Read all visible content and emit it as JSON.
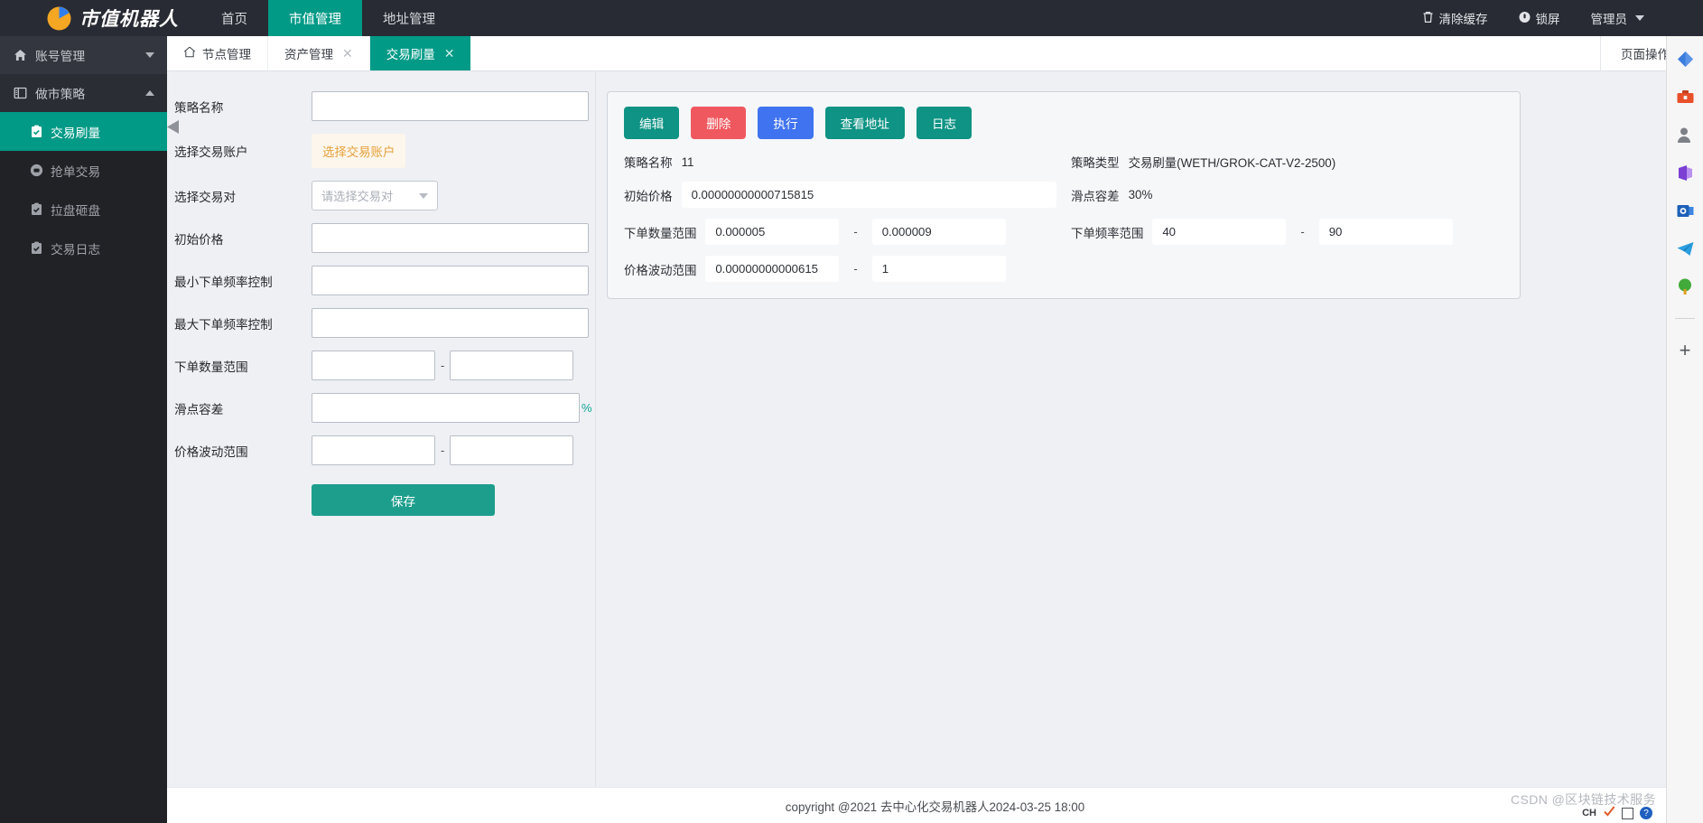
{
  "header": {
    "brand": "市值机器人",
    "nav": [
      {
        "label": "首页",
        "active": false
      },
      {
        "label": "市值管理",
        "active": true
      },
      {
        "label": "地址管理",
        "active": false
      }
    ],
    "right": [
      {
        "label": "清除缓存",
        "icon": "trash-icon"
      },
      {
        "label": "锁屏",
        "icon": "lock-icon"
      },
      {
        "label": "管理员",
        "icon": "caret-down-icon"
      }
    ]
  },
  "sidebar": {
    "groups": [
      {
        "label": "账号管理",
        "icon": "home-icon",
        "expanded": false,
        "items": []
      },
      {
        "label": "做市策略",
        "icon": "book-icon",
        "expanded": true,
        "items": [
          {
            "label": "交易刷量",
            "icon": "clipboard-check-icon",
            "active": true
          },
          {
            "label": "抢单交易",
            "icon": "circle-dot-icon",
            "active": false
          },
          {
            "label": "拉盘砸盘",
            "icon": "clipboard-check-icon",
            "active": false
          },
          {
            "label": "交易日志",
            "icon": "clipboard-check-icon",
            "active": false
          }
        ]
      }
    ]
  },
  "tabs": {
    "items": [
      {
        "label": "节点管理",
        "icon": "home-icon",
        "closable": false,
        "active": false
      },
      {
        "label": "资产管理",
        "icon": "",
        "closable": true,
        "active": false
      },
      {
        "label": "交易刷量",
        "icon": "",
        "closable": true,
        "active": true
      }
    ],
    "close_glyph": "✕",
    "page_ops": "页面操作"
  },
  "form": {
    "strategy_name": {
      "label": "策略名称",
      "value": "",
      "placeholder": ""
    },
    "select_account": {
      "label": "选择交易账户",
      "button_label": "选择交易账户"
    },
    "select_pair": {
      "label": "选择交易对",
      "placeholder": "请选择交易对",
      "value": ""
    },
    "initial_price": {
      "label": "初始价格",
      "value": "",
      "placeholder": ""
    },
    "min_freq": {
      "label": "最小下单频率控制",
      "value": "",
      "placeholder": ""
    },
    "max_freq": {
      "label": "最大下单频率控制",
      "value": "",
      "placeholder": ""
    },
    "amount_range": {
      "label": "下单数量范围",
      "from": "",
      "to": "",
      "separator": "-"
    },
    "slippage": {
      "label": "滑点容差",
      "value": "",
      "suffix": "%"
    },
    "price_range": {
      "label": "价格波动范围",
      "from": "",
      "to": "",
      "separator": "-"
    },
    "save_label": "保存"
  },
  "detail": {
    "buttons": [
      {
        "label": "编辑",
        "color": "#0e9384"
      },
      {
        "label": "删除",
        "color": "#f0585f"
      },
      {
        "label": "执行",
        "color": "#4073ef"
      },
      {
        "label": "查看地址",
        "color": "#0e9384"
      },
      {
        "label": "日志",
        "color": "#0e9384"
      }
    ],
    "fields": {
      "strategy_name_label": "策略名称",
      "strategy_name_value": "11",
      "strategy_type_label": "策略类型",
      "strategy_type_value": "交易刷量(WETH/GROK-CAT-V2-2500)",
      "initial_price_label": "初始价格",
      "initial_price_value": "0.00000000000715815",
      "slippage_label": "滑点容差",
      "slippage_value": "30%",
      "amount_range_label": "下单数量范围",
      "amount_from": "0.000005",
      "amount_to": "0.000009",
      "freq_range_label": "下单频率范围",
      "freq_from": "40",
      "freq_to": "90",
      "price_range_label": "价格波动范围",
      "price_from": "0.00000000000615",
      "price_to": "1",
      "separator": "-"
    }
  },
  "footer": {
    "text": "copyright @2021 去中心化交易机器人2024-03-25 18:00"
  },
  "watermark": {
    "text": "CSDN @区块链技术服务"
  },
  "tray": {
    "lang": "CH",
    "help": "?"
  },
  "rail": {
    "icons": [
      {
        "name": "diamond-blue-icon"
      },
      {
        "name": "toolbox-icon"
      },
      {
        "name": "contact-icon"
      },
      {
        "name": "office-icon"
      },
      {
        "name": "outlook-icon"
      },
      {
        "name": "telegram-icon"
      },
      {
        "name": "tree-icon"
      }
    ],
    "add_label": "+"
  },
  "colors": {
    "brand_teal": "#009a86",
    "header_dark": "#282b33",
    "sidebar_dark": "#212226",
    "warn_orange": "#e6a23c",
    "danger_red": "#f0585f",
    "primary_blue": "#4073ef"
  }
}
